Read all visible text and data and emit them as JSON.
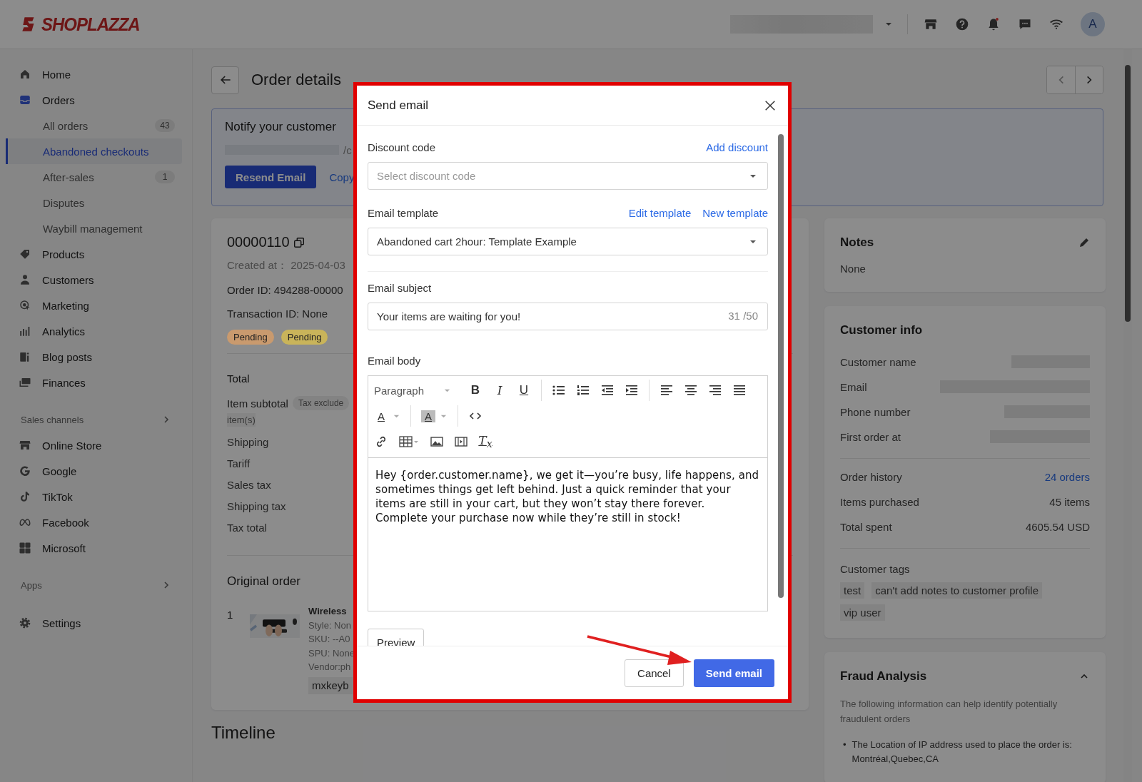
{
  "topbar": {
    "logo": "SHOPLAZZA",
    "avatar": "A"
  },
  "sidebar": {
    "items": [
      {
        "label": "Home",
        "selected": false
      },
      {
        "label": "Orders",
        "selected": false,
        "children": [
          {
            "label": "All orders",
            "count": "43",
            "selected": false
          },
          {
            "label": "Abandoned checkouts",
            "selected": true
          },
          {
            "label": "After-sales",
            "count": "1",
            "selected": false
          },
          {
            "label": "Disputes",
            "selected": false
          },
          {
            "label": "Waybill management",
            "selected": false
          }
        ]
      },
      {
        "label": "Products",
        "selected": false
      },
      {
        "label": "Customers",
        "selected": false
      },
      {
        "label": "Marketing",
        "selected": false
      },
      {
        "label": "Analytics",
        "selected": false
      },
      {
        "label": "Blog posts",
        "selected": false
      },
      {
        "label": "Finances",
        "selected": false
      }
    ],
    "sections": [
      {
        "title": "Sales channels",
        "items": [
          {
            "label": "Online Store",
            "selected": false
          },
          {
            "label": "Google",
            "selected": false
          },
          {
            "label": "TikTok",
            "selected": false
          },
          {
            "label": "Facebook",
            "selected": false
          },
          {
            "label": "Microsoft",
            "selected": false
          }
        ]
      },
      {
        "title": "Apps"
      }
    ],
    "footer_items": [
      {
        "label": "Settings",
        "selected": false
      }
    ]
  },
  "page": {
    "title": "Order details"
  },
  "banner": {
    "title": "Notify your customer",
    "link_tail": "/c",
    "buttons": [
      {
        "label": "Resend Email",
        "kind": "primary"
      },
      {
        "label": "Copy",
        "kind": "link"
      }
    ]
  },
  "order": {
    "number": "00000110",
    "created": "Created at：  2025-04-03",
    "order_id": "Order ID: 494288-00000",
    "transaction": "Transaction ID: None",
    "tags": [
      {
        "label": "Pending",
        "color": "#c99a6e"
      },
      {
        "label": "Pending",
        "color": "#c9b45a"
      }
    ],
    "totals": {
      "title": "Total",
      "subtotal_label": "Item subtotal",
      "subtotal_badge": "Tax exclude",
      "items_note": "item(s)",
      "rows": [
        "Shipping",
        "Tariff",
        "Sales tax",
        "Shipping tax",
        "Tax total"
      ]
    },
    "original_order": {
      "title": "Original order",
      "index": "1",
      "name": "Wireless",
      "details": [
        "Style: Non",
        "SKU: --A0",
        "SPU: None",
        "Vendor:ph"
      ],
      "chip": "mxkeyb"
    }
  },
  "timeline": {
    "title": "Timeline"
  },
  "notes": {
    "title": "Notes",
    "value": "None"
  },
  "customer_info": {
    "title": "Customer info",
    "fields": [
      "Customer name",
      "Email",
      "Phone number",
      "First order at"
    ],
    "stats": [
      {
        "label": "Order history",
        "value": "24 orders",
        "kind": "link"
      },
      {
        "label": "Items purchased",
        "value": "45 items",
        "kind": "text"
      },
      {
        "label": "Total spent",
        "value": "4605.54 USD",
        "kind": "text"
      }
    ],
    "tags_title": "Customer tags",
    "tags": [
      "test",
      "can't add notes to customer profile",
      "vip user"
    ]
  },
  "fraud": {
    "title": "Fraud Analysis",
    "expanded": true,
    "description": "The following information can help identify potentially fraudulent orders",
    "bullets": [
      {
        "marker": "•",
        "text": "The Location of IP address used to place the order is: Montréal,Quebec,CA"
      }
    ]
  },
  "modal": {
    "title": "Send email",
    "discount": {
      "label": "Discount code",
      "action": "Add discount",
      "placeholder": "Select discount code"
    },
    "template": {
      "label": "Email template",
      "actions": [
        "Edit template",
        "New template"
      ],
      "value": "Abandoned cart 2hour: Template Example"
    },
    "subject": {
      "label": "Email subject",
      "value": "Your items are waiting for you!",
      "counter": "31 /50"
    },
    "body": {
      "label": "Email body",
      "block_format": "Paragraph",
      "format_buttons": [
        "B",
        "I",
        "U"
      ],
      "color_buttons": [
        "A",
        "A"
      ],
      "clear_format": "T$_{x}$",
      "text": "Hey {order.customer.name}, we get it—you’re busy, life happens, and sometimes things get left behind. Just a quick reminder that your items are still in your cart, but they won’t stay there forever. Complete your purchase now while they’re still in stock!"
    },
    "preview_button": "Preview",
    "buttons": [
      {
        "label": "Cancel",
        "kind": "secondary"
      },
      {
        "label": "Send email",
        "kind": "primary"
      }
    ]
  }
}
